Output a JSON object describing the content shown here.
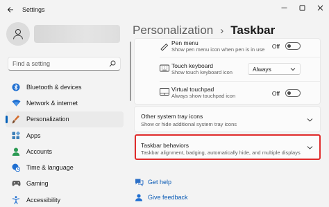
{
  "window": {
    "title": "Settings"
  },
  "sidebar": {
    "search_placeholder": "Find a setting",
    "items": [
      {
        "label": "Bluetooth & devices",
        "icon": "bluetooth-icon",
        "color": "#1f6fd1"
      },
      {
        "label": "Network & internet",
        "icon": "wifi-icon",
        "color": "#1f6fd1"
      },
      {
        "label": "Personalization",
        "icon": "brush-icon",
        "color": "#d36b2b",
        "active": true
      },
      {
        "label": "Apps",
        "icon": "apps-icon",
        "color": "#3d7fb8"
      },
      {
        "label": "Accounts",
        "icon": "person-icon",
        "color": "#2a9a53"
      },
      {
        "label": "Time & language",
        "icon": "globe-clock-icon",
        "color": "#1f6fd1"
      },
      {
        "label": "Gaming",
        "icon": "gamepad-icon",
        "color": "#5b5b5b"
      },
      {
        "label": "Accessibility",
        "icon": "accessibility-icon",
        "color": "#1f6fd1"
      }
    ]
  },
  "breadcrumb": {
    "parent": "Personalization",
    "separator": "›",
    "current": "Taskbar"
  },
  "tray_icons": [
    {
      "title": "Pen menu",
      "desc": "Show pen menu icon when pen is in use",
      "control": "toggle",
      "state": "Off",
      "icon": "pen-icon"
    },
    {
      "title": "Touch keyboard",
      "desc": "Show touch keyboard icon",
      "control": "dropdown",
      "value": "Always",
      "icon": "keyboard-icon"
    },
    {
      "title": "Virtual touchpad",
      "desc": "Always show touchpad icon",
      "control": "toggle",
      "state": "Off",
      "icon": "touchpad-icon"
    }
  ],
  "sections": [
    {
      "title": "Other system tray icons",
      "desc": "Show or hide additional system tray icons"
    },
    {
      "title": "Taskbar behaviors",
      "desc": "Taskbar alignment, badging, automatically hide, and multiple displays"
    }
  ],
  "links": [
    {
      "label": "Get help",
      "icon": "help-icon"
    },
    {
      "label": "Give feedback",
      "icon": "feedback-icon"
    }
  ],
  "colors": {
    "accent": "#005fb8",
    "highlight": "#e02b2b",
    "link": "#0a5bb5"
  }
}
